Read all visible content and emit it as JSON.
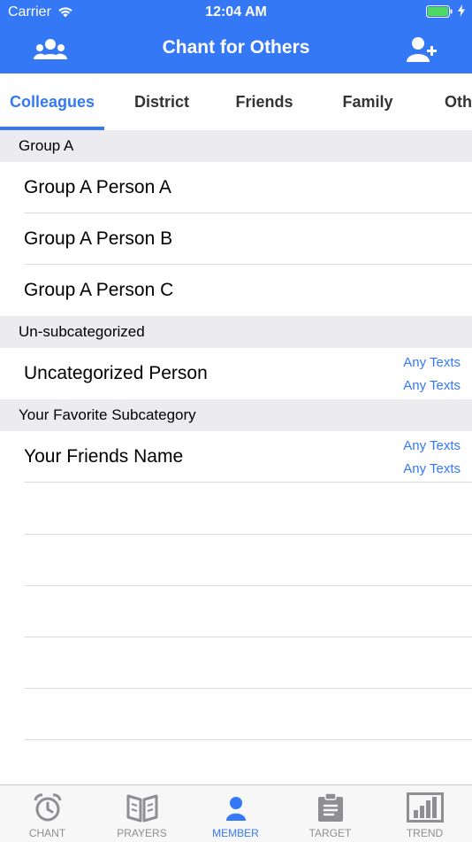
{
  "status_bar": {
    "carrier": "Carrier",
    "time": "12:04 AM"
  },
  "nav": {
    "title": "Chant for Others",
    "left_icon": "group-icon",
    "right_icon": "add-person-icon"
  },
  "tabs": [
    {
      "label": "Colleagues",
      "active": true
    },
    {
      "label": "District",
      "active": false
    },
    {
      "label": "Friends",
      "active": false
    },
    {
      "label": "Family",
      "active": false
    },
    {
      "label": "Oth",
      "active": false
    }
  ],
  "sections": [
    {
      "title": "Group A",
      "rows": [
        {
          "label": "Group A Person A"
        },
        {
          "label": "Group A Person B"
        },
        {
          "label": "Group A Person C"
        }
      ]
    },
    {
      "title": "Un-subcategorized",
      "rows": [
        {
          "label": "Uncategorized Person",
          "detail1": "Any Texts",
          "detail2": "Any Texts"
        }
      ]
    },
    {
      "title": "Your Favorite Subcategory",
      "rows": [
        {
          "label": "Your Friends Name",
          "detail1": "Any Texts",
          "detail2": "Any Texts"
        }
      ]
    }
  ],
  "tabbar": [
    {
      "label": "CHANT",
      "icon": "alarm-clock-icon",
      "active": false
    },
    {
      "label": "PRAYERS",
      "icon": "book-icon",
      "active": false
    },
    {
      "label": "MEMBER",
      "icon": "person-icon",
      "active": true
    },
    {
      "label": "TARGET",
      "icon": "clipboard-icon",
      "active": false
    },
    {
      "label": "TREND",
      "icon": "bar-chart-icon",
      "active": false
    }
  ],
  "colors": {
    "accent": "#3478f6",
    "section_bg": "#ebebf0",
    "tabbar_bg": "#f7f7f7",
    "inactive_gray": "#8e8e93"
  }
}
